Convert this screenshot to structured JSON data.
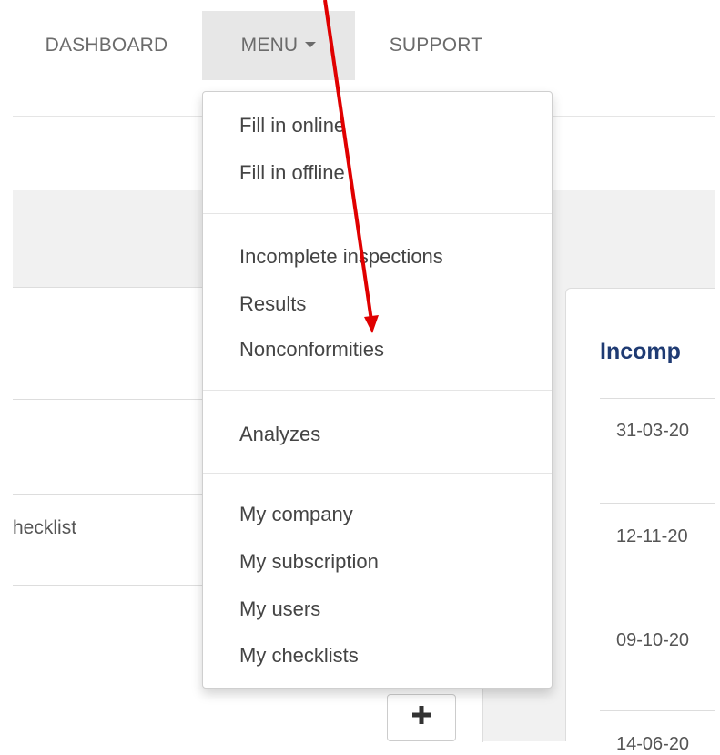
{
  "navbar": {
    "items": [
      {
        "label": "DASHBOARD"
      },
      {
        "label": "MENU"
      },
      {
        "label": "SUPPORT"
      }
    ]
  },
  "background": {
    "left_panel_text": "hecklist",
    "right_panel": {
      "title": "Incomp",
      "dates": [
        "31-03-20",
        "12-11-20",
        "09-10-20",
        "14-06-20"
      ]
    }
  },
  "dropdown": {
    "groups": [
      {
        "items": [
          {
            "label": "Fill in online"
          },
          {
            "label": "Fill in offline"
          }
        ]
      },
      {
        "items": [
          {
            "label": "Incomplete inspections"
          },
          {
            "label": "Results"
          },
          {
            "label": "Nonconformities"
          }
        ]
      },
      {
        "items": [
          {
            "label": "Analyzes"
          }
        ]
      },
      {
        "items": [
          {
            "label": "My company"
          },
          {
            "label": "My subscription"
          },
          {
            "label": "My users"
          },
          {
            "label": "My checklists"
          }
        ]
      }
    ]
  },
  "annotation": {
    "arrow_color": "#e00000"
  },
  "colors": {
    "menu_active_bg": "#e7e7e7",
    "title_blue": "#1f3b73"
  }
}
